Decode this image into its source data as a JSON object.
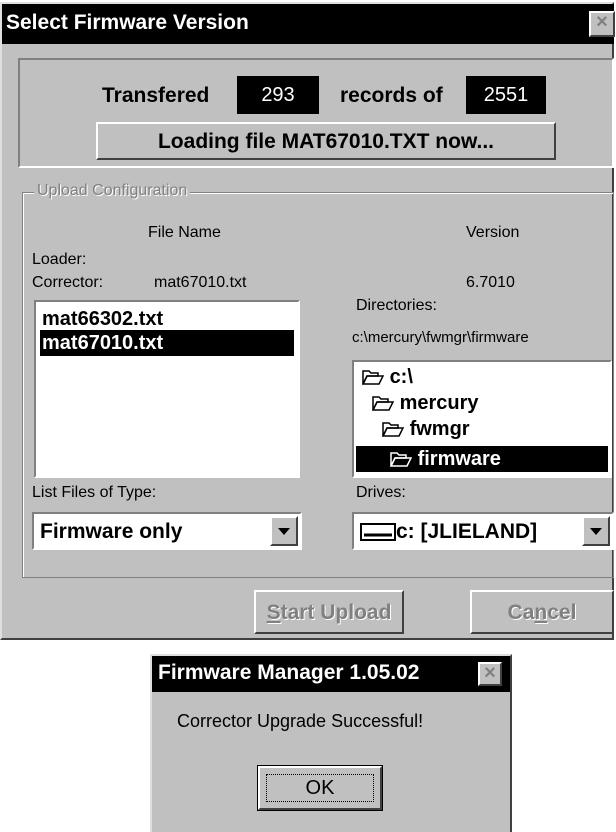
{
  "main_window": {
    "title": "Select Firmware Version",
    "progress": {
      "prefix": "Transfered",
      "records_done": "293",
      "middle": "records of",
      "records_total": "2551",
      "status_message": "Loading file MAT67010.TXT now..."
    },
    "upload_config": {
      "group_label": "Upload Configuration",
      "col_file_name": "File Name",
      "col_version": "Version",
      "loader_label": "Loader:",
      "corrector_label": "Corrector:",
      "corrector_file": "mat67010.txt",
      "corrector_version": "6.7010",
      "files": [
        {
          "name": "mat66302.txt",
          "selected": false
        },
        {
          "name": "mat67010.txt",
          "selected": true
        }
      ],
      "directories_label": "Directories:",
      "current_path": "c:\\mercury\\fwmgr\\firmware",
      "directories": [
        {
          "name": "c:\\",
          "icon": "folder-open-icon",
          "selected": false
        },
        {
          "name": "mercury",
          "icon": "folder-open-icon",
          "selected": false
        },
        {
          "name": "fwmgr",
          "icon": "folder-open-icon",
          "selected": false
        },
        {
          "name": "firmware",
          "icon": "folder-open-icon",
          "selected": true
        }
      ],
      "list_files_label": "List Files of Type:",
      "file_type_value": "Firmware only",
      "drives_label": "Drives:",
      "drive_value": "c: [JLIELAND]"
    },
    "buttons": {
      "start_upload_prefix": "S",
      "start_upload_rest": "tart Upload",
      "cancel_prefix": "Ca",
      "cancel_underlined": "n",
      "cancel_rest": "cel"
    }
  },
  "dialog": {
    "title": "Firmware Manager 1.05.02",
    "message": "Corrector Upgrade Successful!",
    "ok_label": "OK"
  }
}
